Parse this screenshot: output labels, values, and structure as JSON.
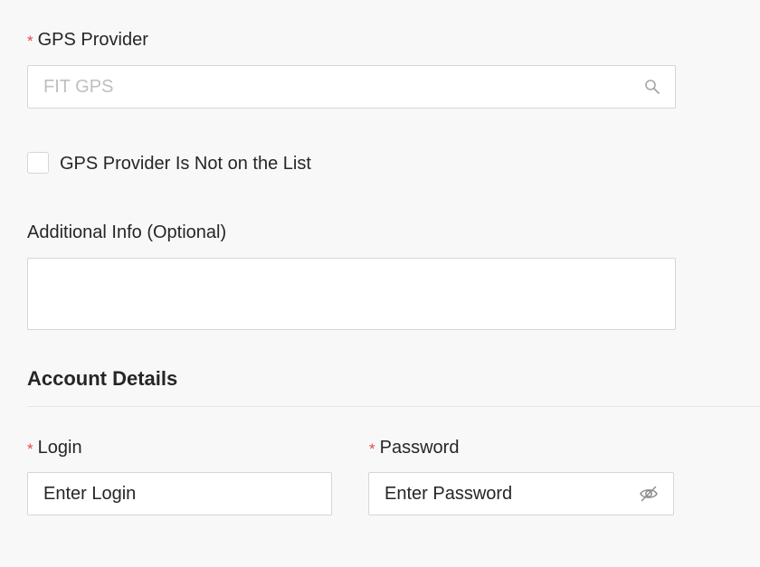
{
  "gps_provider": {
    "label": "GPS Provider",
    "required_mark": "*",
    "placeholder": "FIT GPS",
    "search_icon": "search-icon"
  },
  "not_on_list": {
    "checked": false,
    "label": "GPS Provider Is Not on the List"
  },
  "additional_info": {
    "label": "Additional Info (Optional)",
    "value": ""
  },
  "account_details": {
    "title": "Account Details"
  },
  "login": {
    "label": "Login",
    "required_mark": "*",
    "value": "Enter Login"
  },
  "password": {
    "label": "Password",
    "required_mark": "*",
    "value": "Enter Password",
    "toggle_icon": "eye-off-icon"
  },
  "colors": {
    "background": "#f8f8f8",
    "required": "#e5484d",
    "border": "#d6d6d6",
    "text": "#262626",
    "placeholder": "#bfbfbf"
  }
}
